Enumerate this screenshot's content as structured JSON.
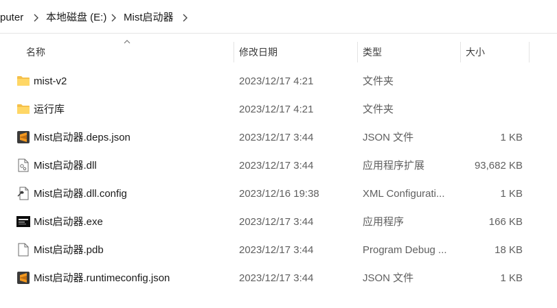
{
  "breadcrumb": {
    "items": [
      "puter",
      "本地磁盘 (E:)",
      "Mist启动器"
    ]
  },
  "columns": {
    "name": "名称",
    "date": "修改日期",
    "type": "类型",
    "size": "大小"
  },
  "files": [
    {
      "name": "mist-v2",
      "date": "2023/12/17 4:21",
      "type": "文件夹",
      "size": "",
      "icon": "folder-icon"
    },
    {
      "name": "运行库",
      "date": "2023/12/17 4:21",
      "type": "文件夹",
      "size": "",
      "icon": "folder-icon"
    },
    {
      "name": "Mist启动器.deps.json",
      "date": "2023/12/17 3:44",
      "type": "JSON 文件",
      "size": "1 KB",
      "icon": "sublime-text-icon"
    },
    {
      "name": "Mist启动器.dll",
      "date": "2023/12/17 3:44",
      "type": "应用程序扩展",
      "size": "93,682 KB",
      "icon": "dll-file-icon"
    },
    {
      "name": "Mist启动器.dll.config",
      "date": "2023/12/16 19:38",
      "type": "XML Configurati...",
      "size": "1 KB",
      "icon": "config-file-icon"
    },
    {
      "name": "Mist启动器.exe",
      "date": "2023/12/17 3:44",
      "type": "应用程序",
      "size": "166 KB",
      "icon": "exe-app-icon"
    },
    {
      "name": "Mist启动器.pdb",
      "date": "2023/12/17 3:44",
      "type": "Program Debug ...",
      "size": "18 KB",
      "icon": "blank-file-icon"
    },
    {
      "name": "Mist启动器.runtimeconfig.json",
      "date": "2023/12/17 3:44",
      "type": "JSON 文件",
      "size": "1 KB",
      "icon": "sublime-text-icon"
    }
  ],
  "colors": {
    "folder": "#f5c04a",
    "sublime": "#f2981f"
  }
}
